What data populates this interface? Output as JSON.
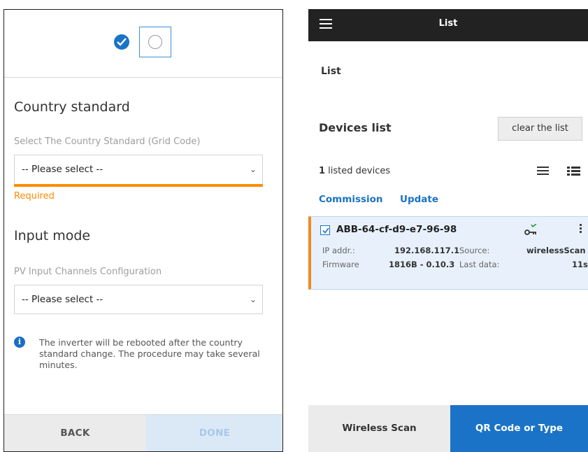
{
  "left": {
    "country_standard": {
      "title": "Country standard",
      "label": "Select The Country Standard (Grid Code)",
      "value": "-- Please select --",
      "error": "Required"
    },
    "input_mode": {
      "title": "Input mode",
      "label": "PV Input Channels Configuration",
      "value": "-- Please select --"
    },
    "info": "The inverter will be rebooted after the country standard change. The procedure may take several minutes.",
    "back_label": "BACK",
    "done_label": "DONE"
  },
  "right": {
    "appbar_title": "List",
    "page_title": "List",
    "devices_title": "Devices list",
    "clear_label": "clear the list",
    "count_number": "1",
    "count_text": " listed devices",
    "tabs": [
      "Commission",
      "Update"
    ],
    "device": {
      "name": "ABB-64-cf-d9-e7-96-98",
      "ip_label": "IP addr.:",
      "ip_value": "192.168.117.1",
      "source_label": "Source:",
      "source_value": "wirelessScan",
      "firmware_label": "Firmware",
      "firmware_value": "1816B - 0.10.3",
      "lastdata_label": "Last data:",
      "lastdata_value": "11s"
    },
    "wireless_label": "Wireless Scan",
    "qr_label": "QR Code or Type"
  },
  "colors": {
    "accent": "#1a73c6",
    "warning": "#ff8c00",
    "topbar": "#222222"
  }
}
